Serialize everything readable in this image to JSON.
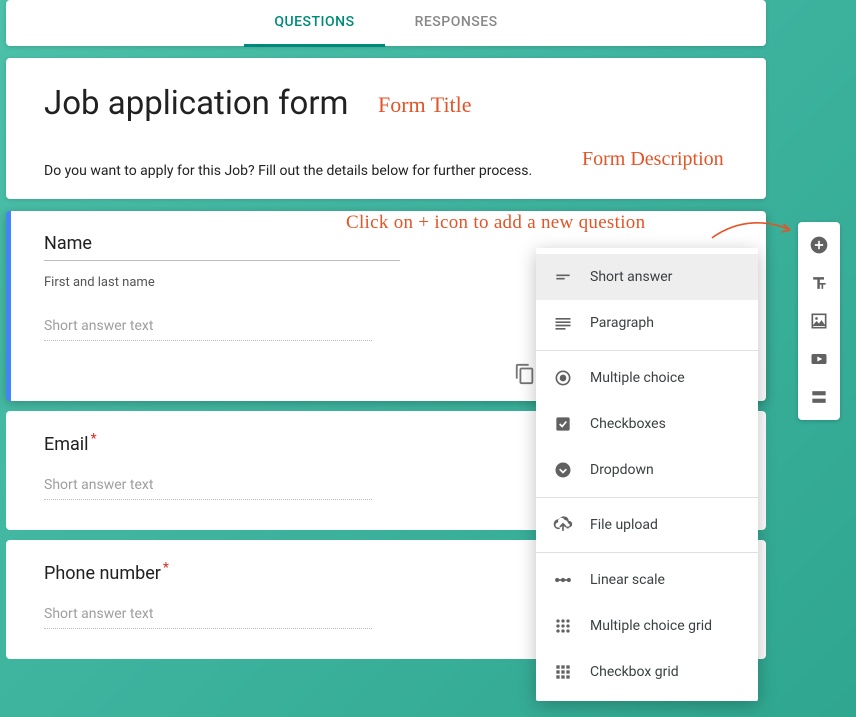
{
  "tabs": {
    "questions": "QUESTIONS",
    "responses": "RESPONSES"
  },
  "form": {
    "title": "Job application form",
    "description": "Do you want to apply for this Job? Fill out the details below for further process."
  },
  "annotations": {
    "title": "Form Title",
    "desc": "Form Description",
    "plus": "Click on + icon to add a new question"
  },
  "q_name": {
    "title": "Name",
    "sub": "First and last name",
    "placeholder": "Short answer text"
  },
  "q_email": {
    "title": "Email",
    "placeholder": "Short answer text"
  },
  "q_phone": {
    "title": "Phone number",
    "placeholder": "Short answer text"
  },
  "menu": {
    "short_answer": "Short answer",
    "paragraph": "Paragraph",
    "multiple_choice": "Multiple choice",
    "checkboxes": "Checkboxes",
    "dropdown": "Dropdown",
    "file_upload": "File upload",
    "linear_scale": "Linear scale",
    "mc_grid": "Multiple choice grid",
    "cb_grid": "Checkbox grid"
  }
}
